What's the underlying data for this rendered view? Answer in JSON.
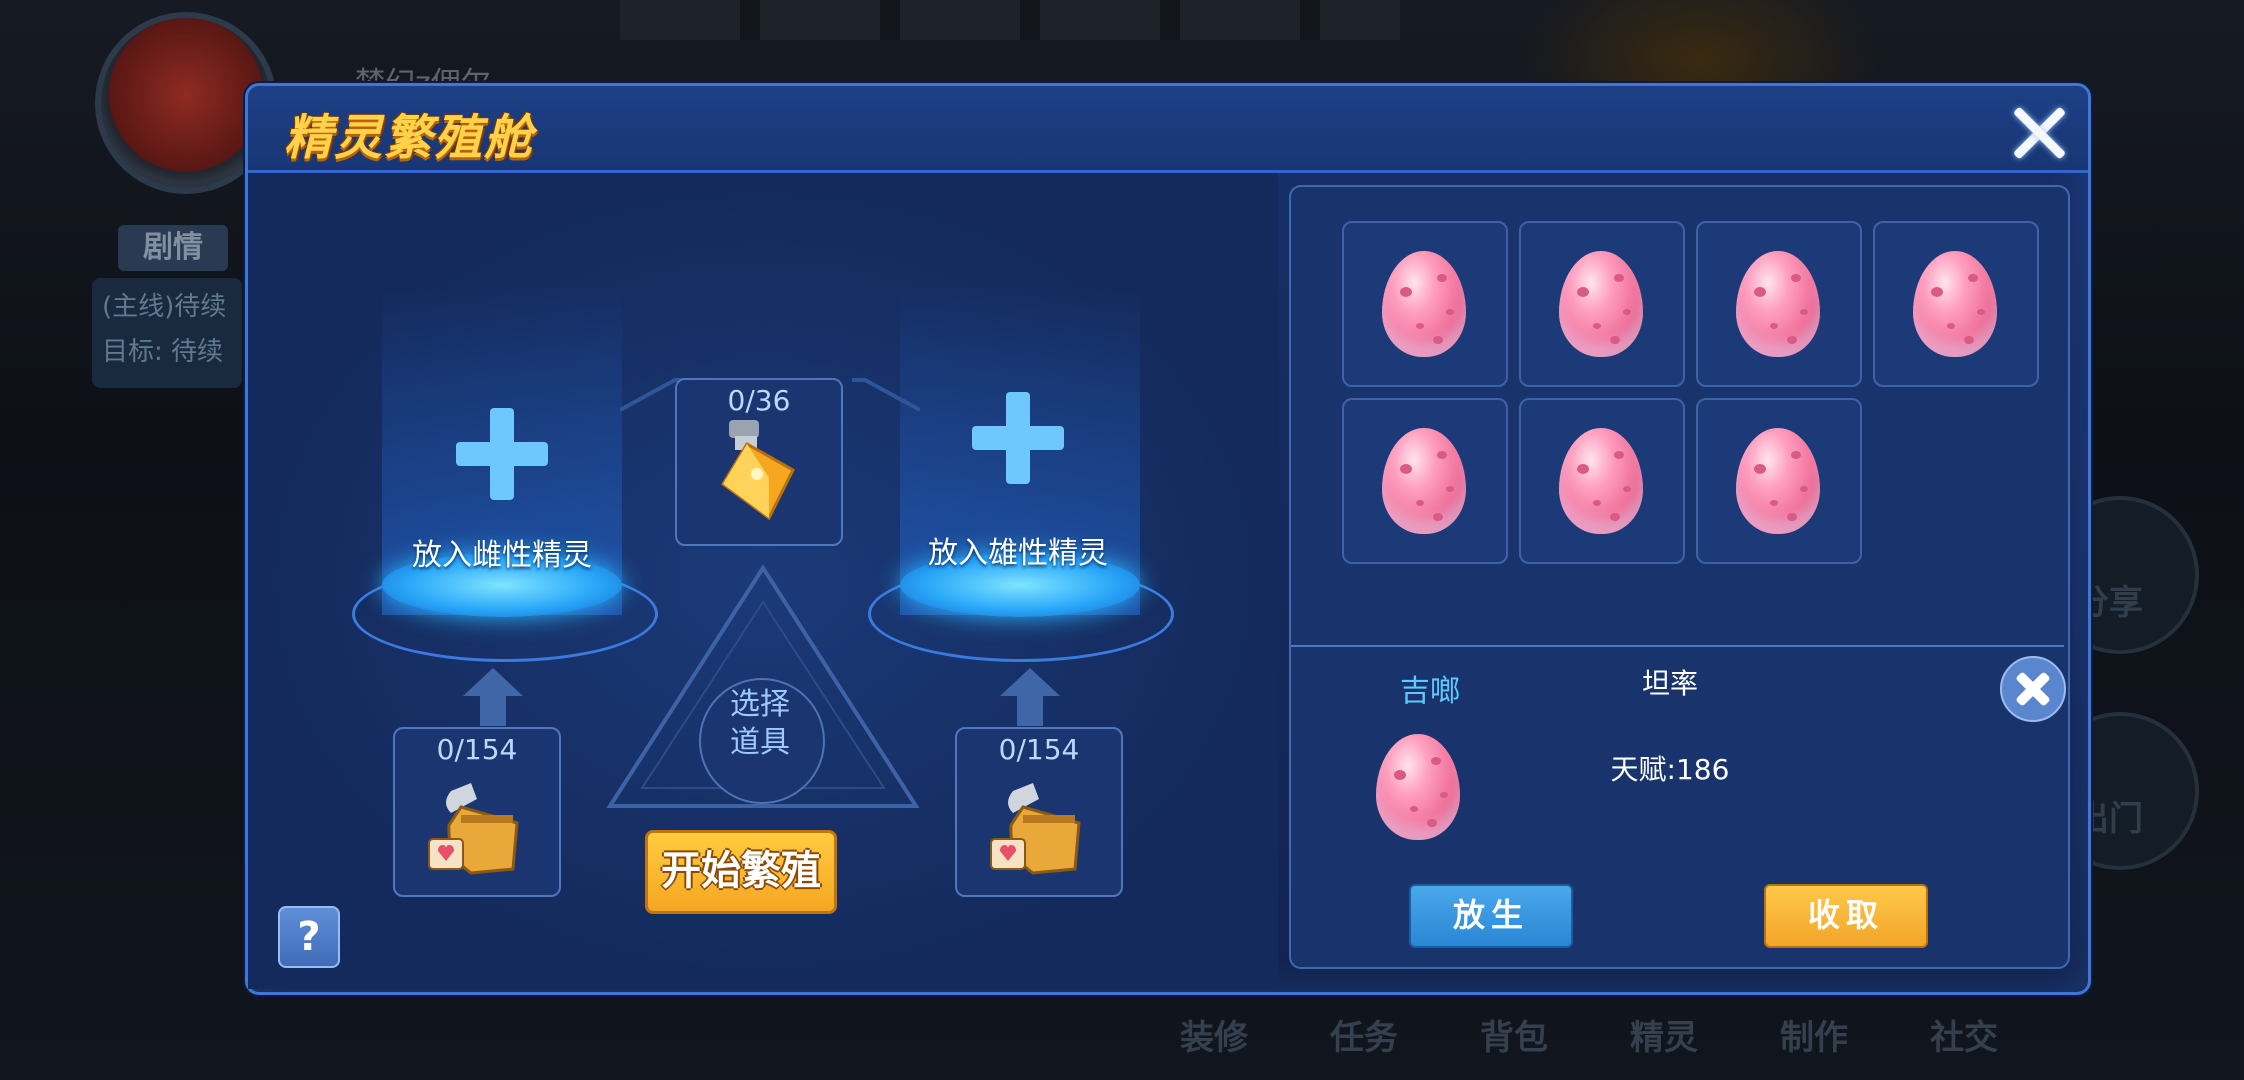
{
  "background": {
    "player_name": "梦幻z佣尔",
    "tab_story": "剧情",
    "quest_line1": "(主线)待续",
    "quest_line2": "目标: 待续",
    "right_btn_share": "分享",
    "right_btn_go_out": "出门",
    "bottom_nav": [
      "装修",
      "任务",
      "背包",
      "精灵",
      "制作",
      "社交"
    ]
  },
  "dialog": {
    "title": "精灵繁殖舱",
    "female_slot_label": "放入雌性精灵",
    "male_slot_label": "放入雄性精灵",
    "center_item_count": "0/36",
    "left_item_count": "0/154",
    "right_item_count": "0/154",
    "select_item_label_line1": "选择",
    "select_item_label_line2": "道具",
    "start_breeding_label": "开始繁殖",
    "help_label": "?"
  },
  "egg_panel": {
    "egg_count": 7,
    "selected": {
      "name": "吉啷",
      "nature": "坦率",
      "talent": "天赋:186"
    },
    "release_label": "放生",
    "collect_label": "收取"
  },
  "colors": {
    "dialog_bg": "#17306a",
    "title": "#ffd24a",
    "accent_blue": "#6ec8ff",
    "button_orange": "#f5a623",
    "button_blue": "#2b86d4",
    "egg_pink": "#f0709a"
  }
}
